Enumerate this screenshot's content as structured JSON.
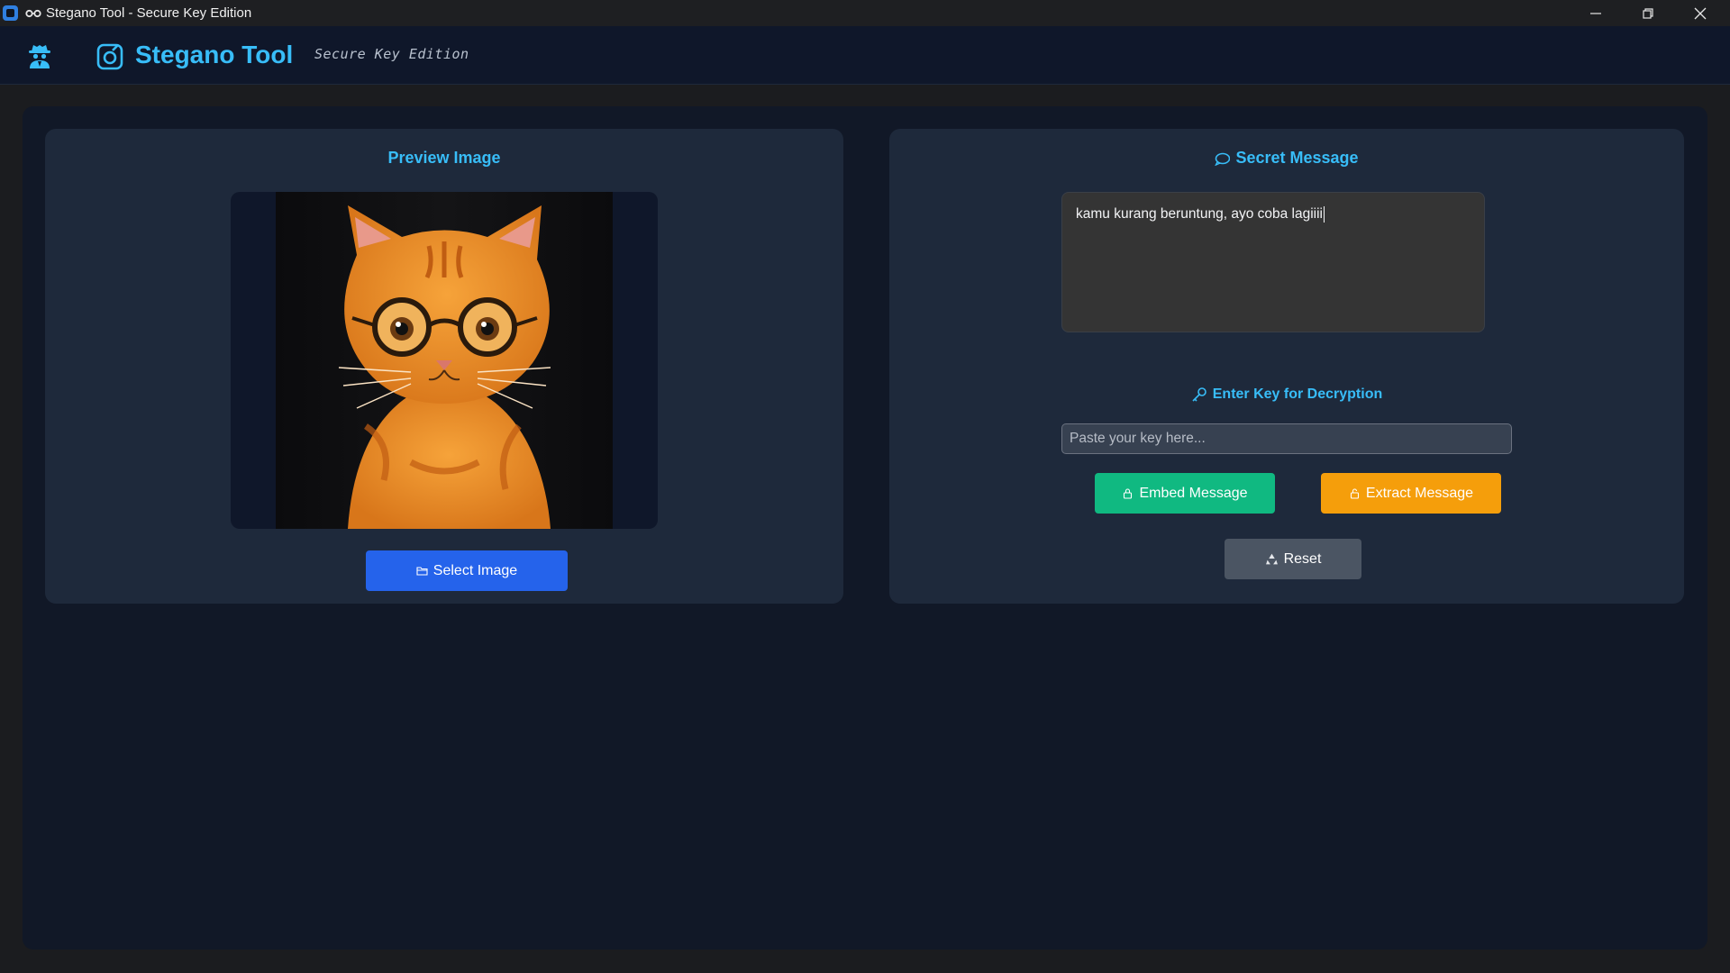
{
  "window": {
    "title": "Stegano Tool - Secure Key Edition"
  },
  "header": {
    "brand": "Stegano Tool",
    "tagline": "Secure Key Edition"
  },
  "preview_panel": {
    "title": "Preview Image",
    "select_button_label": "Select Image"
  },
  "secret_panel": {
    "title": "Secret Message",
    "message_value": "kamu kurang beruntung, ayo coba lagiiii",
    "key_label": "Enter Key for Decryption",
    "key_placeholder": "Paste your key here...",
    "key_value": "",
    "embed_label": "Embed Message",
    "extract_label": "Extract Message",
    "reset_label": "Reset"
  },
  "colors": {
    "accent": "#38bdf8",
    "select_button": "#2563eb",
    "embed_button": "#10b981",
    "extract_button": "#f59e0b",
    "reset_button": "#4b5563"
  }
}
